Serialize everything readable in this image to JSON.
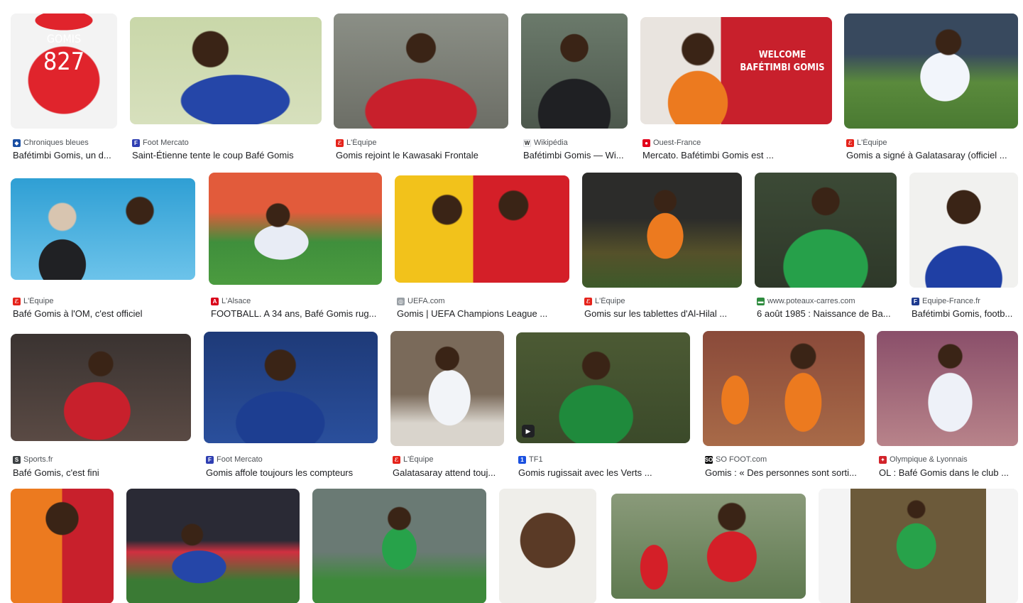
{
  "results": [
    {
      "source": "Chroniques bleues",
      "title": "Bafétimbi Gomis, un d...",
      "favicon": "cb-icon",
      "favicon_color": "#1a4fa3"
    },
    {
      "source": "Foot Mercato",
      "title": "Saint-Étienne tente le coup Bafé Gomis",
      "favicon": "fm-icon",
      "favicon_color": "#2f3fb2"
    },
    {
      "source": "L'Équipe",
      "title": "Gomis rejoint le Kawasaki Frontale",
      "favicon": "lequipe-icon",
      "favicon_color": "#e5231b"
    },
    {
      "source": "Wikipédia",
      "title": "Bafétimbi Gomis — Wi...",
      "favicon": "wikipedia-icon",
      "favicon_color": "#ffffff"
    },
    {
      "source": "Ouest-France",
      "title": "Mercato. Bafétimbi Gomis est ...",
      "favicon": "ouestfrance-icon",
      "favicon_color": "#e2001a"
    },
    {
      "source": "L'Équipe",
      "title": "Gomis a signé à Galatasaray (officiel ...",
      "favicon": "lequipe-icon",
      "favicon_color": "#e5231b"
    },
    {
      "source": "L'Équipe",
      "title": "Bafé Gomis à l'OM, c'est officiel",
      "favicon": "lequipe-icon",
      "favicon_color": "#e5231b"
    },
    {
      "source": "L'Alsace",
      "title": "FOOTBALL. A 34 ans, Bafé Gomis rug...",
      "favicon": "lalsace-icon",
      "favicon_color": "#d9001a"
    },
    {
      "source": "UEFA.com",
      "title": "Gomis | UEFA Champions League ...",
      "favicon": "uefa-icon",
      "favicon_color": "#9aa0a6"
    },
    {
      "source": "L'Équipe",
      "title": "Gomis sur les tablettes d'Al-Hilal ...",
      "favicon": "lequipe-icon",
      "favicon_color": "#e5231b"
    },
    {
      "source": "www.poteaux-carres.com",
      "title": "6 août 1985 : Naissance de Ba...",
      "favicon": "poteaux-icon",
      "favicon_color": "#2e8b3e"
    },
    {
      "source": "Equipe-France.fr",
      "title": "Bafétimbi Gomis, footb...",
      "favicon": "equipefrance-icon",
      "favicon_color": "#1f3b8f"
    },
    {
      "source": "Sports.fr",
      "title": "Bafé Gomis, c'est fini",
      "favicon": "sportsfr-icon",
      "favicon_color": "#3c4043"
    },
    {
      "source": "Foot Mercato",
      "title": "Gomis affole toujours les compteurs",
      "favicon": "fm-icon",
      "favicon_color": "#2f3fb2"
    },
    {
      "source": "L'Équipe",
      "title": "Galatasaray attend touj...",
      "favicon": "lequipe-icon",
      "favicon_color": "#e5231b"
    },
    {
      "source": "TF1",
      "title": "Gomis rugissait avec les Verts ...",
      "favicon": "tf1-icon",
      "favicon_color": "#1a50e0"
    },
    {
      "source": "SO FOOT.com",
      "title": "Gomis : « Des personnes sont sorti...",
      "favicon": "sofoot-icon",
      "favicon_color": "#111111"
    },
    {
      "source": "Olympique & Lyonnais",
      "title": "OL : Bafé Gomis dans le club ...",
      "favicon": "ol-icon",
      "favicon_color": "#d2232a"
    },
    {
      "source": "",
      "title": "",
      "favicon": "",
      "favicon_color": "#ffffff"
    },
    {
      "source": "",
      "title": "",
      "favicon": "",
      "favicon_color": "#ffffff"
    },
    {
      "source": "",
      "title": "",
      "favicon": "",
      "favicon_color": "#ffffff"
    },
    {
      "source": "",
      "title": "",
      "favicon": "",
      "favicon_color": "#ffffff"
    },
    {
      "source": "",
      "title": "",
      "favicon": "",
      "favicon_color": "#ffffff"
    },
    {
      "source": "",
      "title": "",
      "favicon": "",
      "favicon_color": "#ffffff"
    }
  ],
  "overlays": {
    "jersey_name": "GOMIS",
    "jersey_number": "827",
    "welcome_line1": "WELCOME",
    "welcome_line2": "BAFÉTIMBI GOMIS",
    "favicon_letters": {
      "cb-icon": "◆",
      "fm-icon": "F",
      "lequipe-icon": "ℰ",
      "wikipedia-icon": "W",
      "ouestfrance-icon": "●",
      "lalsace-icon": "A",
      "uefa-icon": "◎",
      "poteaux-icon": "▬",
      "equipefrance-icon": "F",
      "sportsfr-icon": "S",
      "tf1-icon": "1",
      "sofoot-icon": "SO",
      "ol-icon": "✦"
    }
  }
}
